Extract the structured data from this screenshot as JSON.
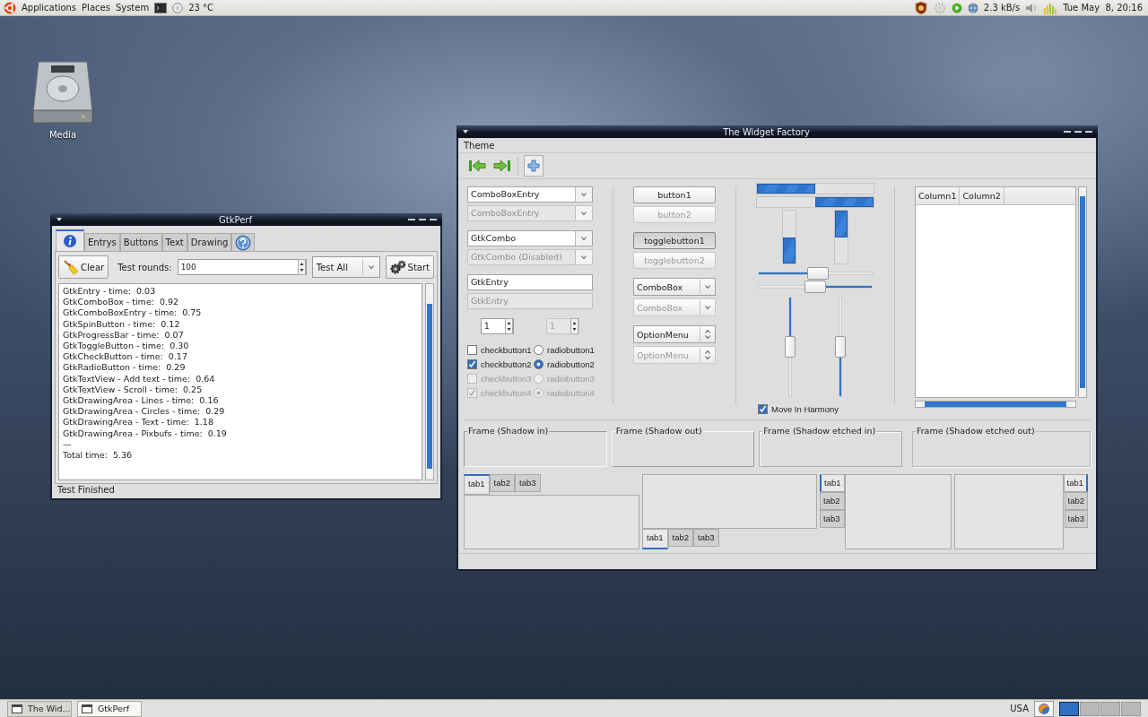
{
  "top_panel": {
    "menus": [
      "Applications",
      "Places",
      "System"
    ],
    "temperature": "23 °C",
    "network_speed": "2.3 kB/s",
    "clock": "Tue May  8, 20:16"
  },
  "desktop_icons": [
    {
      "label": "Media"
    }
  ],
  "gtkperf": {
    "title": "GtkPerf",
    "tabs": [
      {
        "kind": "info",
        "selected": true
      },
      {
        "kind": "label",
        "label": "Entrys",
        "selected": false
      },
      {
        "kind": "label",
        "label": "Buttons",
        "selected": false
      },
      {
        "kind": "label",
        "label": "Text",
        "selected": false
      },
      {
        "kind": "label",
        "label": "Drawing",
        "selected": false
      },
      {
        "kind": "help",
        "selected": false
      }
    ],
    "clear_button": "Clear",
    "rounds_label": "Test rounds:",
    "rounds_value": "100",
    "test_choice": "Test All",
    "start_button": "Start",
    "results": [
      "GtkEntry - time:  0.03",
      "GtkComboBox - time:  0.92",
      "GtkComboBoxEntry - time:  0.75",
      "GtkSpinButton - time:  0.12",
      "GtkProgressBar - time:  0.07",
      "GtkToggleButton - time:  0.30",
      "GtkCheckButton - time:  0.17",
      "GtkRadioButton - time:  0.29",
      "GtkTextView - Add text - time:  0.64",
      "GtkTextView - Scroll - time:  0.25",
      "GtkDrawingArea - Lines - time:  0.16",
      "GtkDrawingArea - Circles - time:  0.29",
      "GtkDrawingArea - Text - time:  1.18",
      "GtkDrawingArea - Pixbufs - time:  0.19",
      "—",
      "Total time:  5.36"
    ],
    "status": "Test Finished"
  },
  "widget_factory": {
    "title": "The Widget Factory",
    "menus": [
      "Theme"
    ],
    "toolbar": [
      {
        "kind": "back",
        "pressed": false
      },
      {
        "kind": "forward",
        "pressed": false
      },
      {
        "kind": "add",
        "pressed": true
      }
    ],
    "combo_entries": [
      {
        "value": "ComboBoxEntry",
        "disabled": false
      },
      {
        "value": "ComboBoxEntry",
        "disabled": true
      }
    ],
    "gtk_combos": [
      {
        "value": "GtkCombo",
        "disabled": false
      },
      {
        "value": "GtkCombo (Disabled)",
        "disabled": true
      }
    ],
    "entries": [
      {
        "value": "GtkEntry",
        "disabled": false
      },
      {
        "value": "GtkEntry",
        "disabled": true
      }
    ],
    "spin_buttons": [
      {
        "value": "1",
        "disabled": false
      },
      {
        "value": "1",
        "disabled": true
      }
    ],
    "check_buttons": [
      {
        "label": "checkbutton1",
        "checked": false,
        "disabled": false
      },
      {
        "label": "checkbutton2",
        "checked": true,
        "disabled": false
      },
      {
        "label": "checkbutton3",
        "checked": false,
        "disabled": true
      },
      {
        "label": "checkbutton4",
        "checked": true,
        "disabled": true
      }
    ],
    "radio_buttons": [
      {
        "label": "radiobutton1",
        "selected": false,
        "disabled": false
      },
      {
        "label": "radiobutton2",
        "selected": true,
        "disabled": false
      },
      {
        "label": "radiobutton3",
        "selected": false,
        "disabled": true
      },
      {
        "label": "radiobutton4",
        "selected": true,
        "disabled": true
      }
    ],
    "buttons": [
      {
        "label": "button1",
        "disabled": false
      },
      {
        "label": "button2",
        "disabled": true
      }
    ],
    "toggle_buttons": [
      {
        "label": "togglebutton1",
        "on": true,
        "disabled": false
      },
      {
        "label": "togglebutton2",
        "on": false,
        "disabled": true
      }
    ],
    "combo_boxes": [
      {
        "value": "ComboBox",
        "disabled": false
      },
      {
        "value": "ComboBox",
        "disabled": true
      }
    ],
    "option_menus": [
      {
        "value": "OptionMenu",
        "disabled": false
      },
      {
        "value": "OptionMenu",
        "disabled": true
      }
    ],
    "progress_bars": [
      {
        "kind": "ltr",
        "level": 0.5
      },
      {
        "kind": "rtl",
        "level": 0.5
      }
    ],
    "vertical_progress_bars": [
      {
        "kind": "btt",
        "level": 0.5
      },
      {
        "kind": "ttb",
        "level": 0.5
      }
    ],
    "hscales": [
      {
        "inverted": false,
        "level": 0.52
      },
      {
        "inverted": true,
        "level": 0.5
      }
    ],
    "vscales": [
      {
        "inverted": false,
        "level": 0.5
      },
      {
        "inverted": true,
        "level": 0.5
      }
    ],
    "harmony_check": {
      "label": "Move In Harmony",
      "checked": true
    },
    "tree_columns": [
      "Column1",
      "Column2"
    ],
    "frames": [
      {
        "label": "Frame (Shadow in)",
        "kind": "in"
      },
      {
        "label": "Frame (Shadow out)",
        "kind": "out"
      },
      {
        "label": "Frame (Shadow etched in)",
        "kind": "etched_in"
      },
      {
        "label": "Frame (Shadow etched out)",
        "kind": "etched_out"
      }
    ],
    "notebooks": [
      {
        "kind": "top",
        "tabs": [
          {
            "label": "tab1",
            "selected": true
          },
          {
            "label": "tab2",
            "selected": false
          },
          {
            "label": "tab3",
            "selected": false
          }
        ]
      },
      {
        "kind": "bottom",
        "tabs": [
          {
            "label": "tab1",
            "selected": true
          },
          {
            "label": "tab2",
            "selected": false
          },
          {
            "label": "tab3",
            "selected": false
          }
        ]
      },
      {
        "kind": "left",
        "tabs": [
          {
            "label": "tab1",
            "selected": true
          },
          {
            "label": "tab2",
            "selected": false
          },
          {
            "label": "tab3",
            "selected": false
          }
        ]
      },
      {
        "kind": "right",
        "tabs": [
          {
            "label": "tab1",
            "selected": true
          },
          {
            "label": "tab2",
            "selected": false
          },
          {
            "label": "tab3",
            "selected": false
          }
        ]
      }
    ]
  },
  "taskbar": {
    "tasks": [
      {
        "label": "The Wid...",
        "selected": false
      },
      {
        "label": "GtkPerf",
        "selected": true
      }
    ],
    "keyboard_layout": "USA",
    "workspaces": [
      {
        "selected": true
      },
      {
        "selected": false
      },
      {
        "selected": false
      },
      {
        "selected": false
      }
    ]
  }
}
